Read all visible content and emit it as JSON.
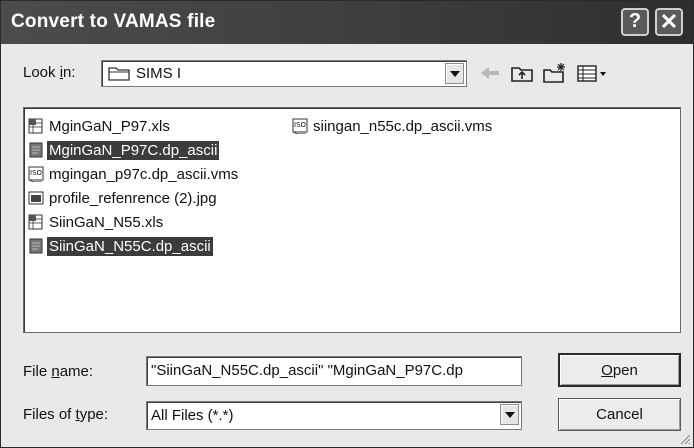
{
  "window": {
    "title": "Convert to VAMAS file",
    "help_glyph": "?",
    "close_glyph": "✕"
  },
  "lookin": {
    "label_pre": "Look ",
    "label_key": "i",
    "label_post": "n:",
    "value": "SIMS I"
  },
  "toolbar": {
    "icons": [
      "back-arrow-icon",
      "up-folder-icon",
      "new-folder-icon",
      "view-menu-icon"
    ]
  },
  "files": [
    {
      "name": "MginGaN_P97.xls",
      "icon": "excel-file-icon",
      "selected": false
    },
    {
      "name": "MginGaN_P97C.dp_ascii",
      "icon": "generic-file-icon",
      "selected": true
    },
    {
      "name": "mgingan_p97c.dp_ascii.vms",
      "icon": "iso-file-icon",
      "selected": false
    },
    {
      "name": "profile_refenrence (2).jpg",
      "icon": "image-file-icon",
      "selected": false
    },
    {
      "name": "SiinGaN_N55.xls",
      "icon": "excel-file-icon",
      "selected": false
    },
    {
      "name": "SiinGaN_N55C.dp_ascii",
      "icon": "generic-file-icon",
      "selected": true
    },
    {
      "name": "siingan_n55c.dp_ascii.vms",
      "icon": "iso-file-icon",
      "selected": false
    }
  ],
  "filename": {
    "label_pre": "File ",
    "label_key": "n",
    "label_post": "ame:",
    "value": "\"SiinGaN_N55C.dp_ascii\" \"MginGaN_P97C.dp"
  },
  "filetype": {
    "label_pre": "Files of ",
    "label_key": "t",
    "label_post": "ype:",
    "value": "All Files (*.*)"
  },
  "buttons": {
    "open_key": "O",
    "open_rest": "pen",
    "cancel": "Cancel"
  }
}
